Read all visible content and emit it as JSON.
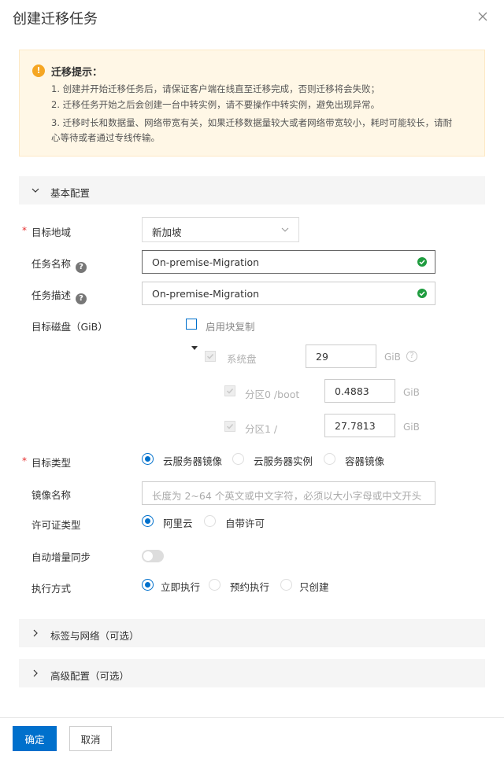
{
  "dialog": {
    "title": "创建迁移任务"
  },
  "notice": {
    "title": "迁移提示：",
    "lines": [
      "1. 创建并开始迁移任务后，请保证客户端在线直至迁移完成，否则迁移将会失败；",
      "2. 迁移任务开始之后会创建一台中转实例，请不要操作中转实例，避免出现异常。",
      "3. 迁移时长和数据量、网络带宽有关，如果迁移数据量较大或者网络带宽较小，耗时可能较长，请耐",
      "心等待或者通过专线传输。"
    ]
  },
  "sections": {
    "basic": "基本配置",
    "tags_network": "标签与网络（可选）",
    "advanced": "高级配置（可选）"
  },
  "form": {
    "region": {
      "label": "目标地域",
      "value": "新加坡"
    },
    "task_name": {
      "label": "任务名称",
      "value": "On-premise-Migration"
    },
    "task_desc": {
      "label": "任务描述",
      "value": "On-premise-Migration"
    },
    "disk": {
      "label": "目标磁盘（GiB）",
      "block_copy_label": "启用块复制",
      "system_disk": {
        "label": "系统盘",
        "value": "29",
        "unit": "GiB"
      },
      "partitions": [
        {
          "label": "分区0 /boot",
          "value": "0.4883",
          "unit": "GiB"
        },
        {
          "label": "分区1 /",
          "value": "27.7813",
          "unit": "GiB"
        }
      ]
    },
    "target_type": {
      "label": "目标类型",
      "options": [
        "云服务器镜像",
        "云服务器实例",
        "容器镜像"
      ],
      "selected": 0
    },
    "image_name": {
      "label": "镜像名称",
      "placeholder": "长度为 2~64 个英文或中文字符，必须以大小字母或中文开头"
    },
    "license": {
      "label": "许可证类型",
      "options": [
        "阿里云",
        "自带许可"
      ],
      "selected": 0
    },
    "auto_sync": {
      "label": "自动增量同步",
      "enabled": false
    },
    "exec_mode": {
      "label": "执行方式",
      "options": [
        "立即执行",
        "预约执行",
        "只创建"
      ],
      "selected": 0
    }
  },
  "footer": {
    "confirm": "确定",
    "cancel": "取消"
  },
  "colors": {
    "primary": "#0070cc",
    "notice_bg": "#fff7e6",
    "warning": "#f5a623",
    "success": "#1f9c3f",
    "required": "#e62e2e"
  }
}
